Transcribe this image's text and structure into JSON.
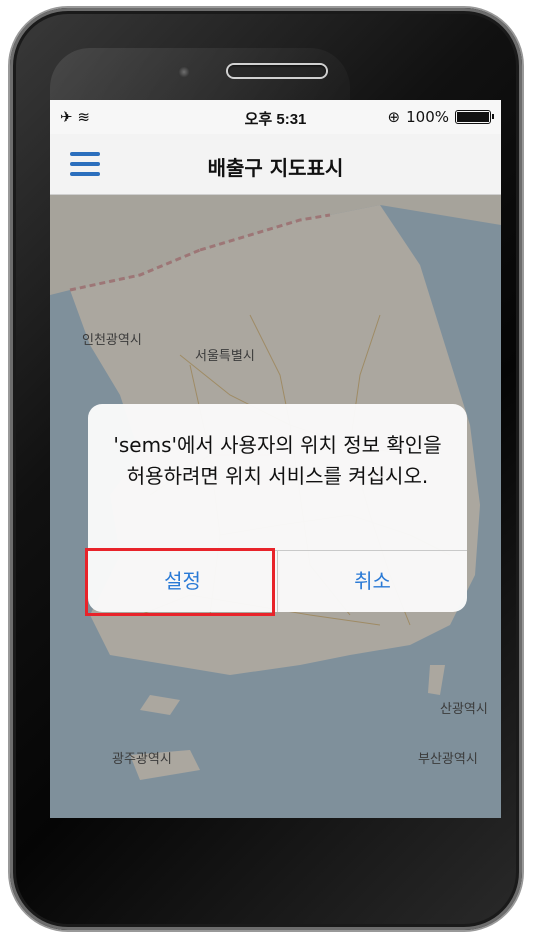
{
  "statusbar": {
    "left_icons": "✈ ≋",
    "time": "오후 5:31",
    "battery_text": "100%"
  },
  "navbar": {
    "title": "배출구 지도표시"
  },
  "map": {
    "labels": {
      "incheon": "인천광역시",
      "seoul": "서울특별시",
      "gwangju": "광주광역시",
      "busan": "부산광역시",
      "ulsan": "산광역시"
    }
  },
  "alert": {
    "message": "'sems'에서 사용자의 위치 정보 확인을 허용하려면 위치 서비스를 켜십시오.",
    "settings_label": "설정",
    "cancel_label": "취소"
  },
  "colors": {
    "accent": "#2a7ad6",
    "highlight": "#e8232a"
  }
}
